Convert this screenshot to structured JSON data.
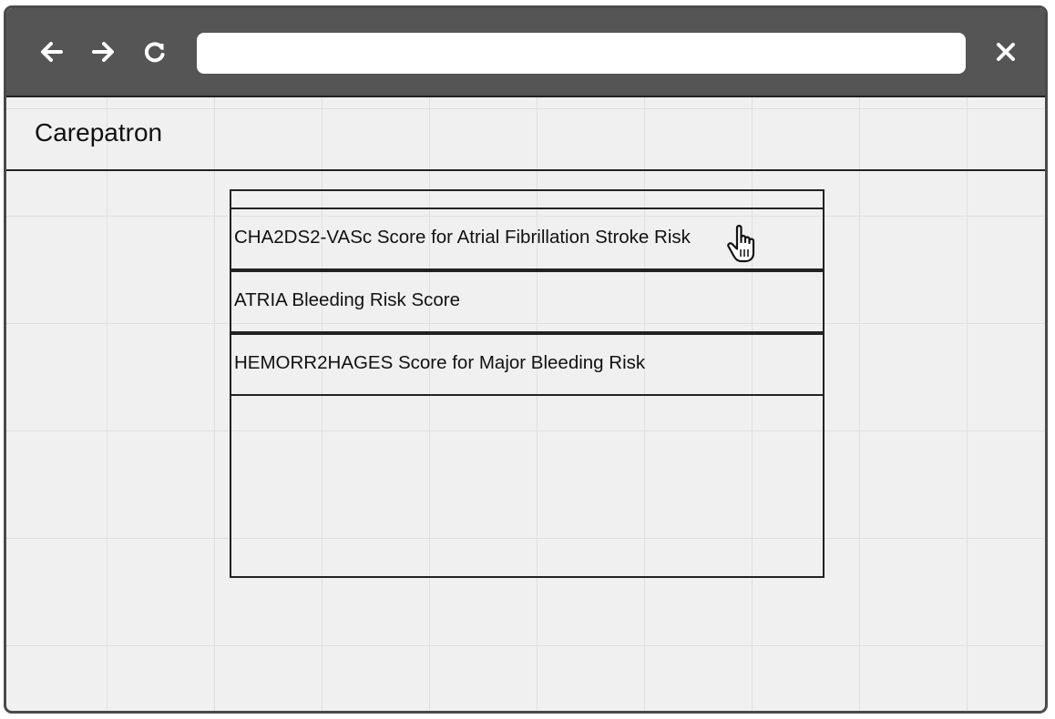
{
  "browser": {
    "back_icon": "arrow-left-icon",
    "forward_icon": "arrow-right-icon",
    "reload_icon": "reload-icon",
    "close_icon": "close-icon",
    "url_value": ""
  },
  "app": {
    "title": "Carepatron"
  },
  "results": {
    "items": [
      {
        "label": "CHA2DS2-VASc Score for Atrial Fibrillation Stroke Risk"
      },
      {
        "label": "ATRIA Bleeding Risk Score"
      },
      {
        "label": "HEMORR2HAGES Score for Major Bleeding Risk"
      }
    ]
  },
  "cursor_icon": "hand-pointer-icon"
}
